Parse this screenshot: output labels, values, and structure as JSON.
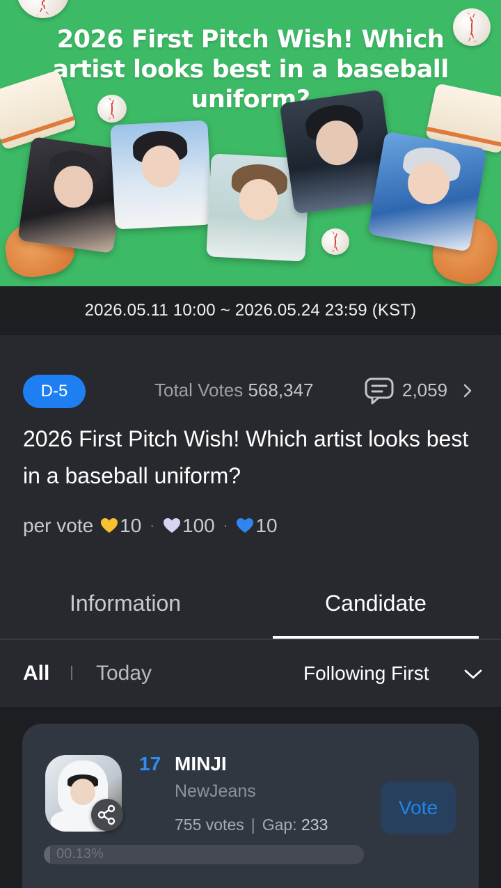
{
  "banner": {
    "title": "2026 First Pitch Wish! Which artist looks best in a baseball uniform?"
  },
  "period": "2026.05.11 10:00 ~ 2026.05.24 23:59 (KST)",
  "info": {
    "dday": "D-5",
    "total_label": "Total Votes",
    "total_value": "568,347",
    "comment_count": "2,059",
    "title": "2026 First Pitch Wish! Which artist looks best in a baseball uniform?",
    "per_vote_label": "per vote",
    "per_vote": [
      {
        "value": "10",
        "color": "#f5c12e",
        "icon": "yellow-heart-icon"
      },
      {
        "value": "100",
        "color": "#d6d4f2",
        "icon": "lavender-heart-icon"
      },
      {
        "value": "10",
        "color": "#2f86f0",
        "icon": "blue-heart-icon"
      }
    ],
    "per_vote_separator": "·"
  },
  "tabs": {
    "information": "Information",
    "candidate": "Candidate",
    "active": "candidate"
  },
  "filter": {
    "all": "All",
    "today": "Today",
    "sort": "Following First"
  },
  "candidates": [
    {
      "rank": "17",
      "name": "MINJI",
      "group": "NewJeans",
      "votes": "755 votes",
      "gap_label": "Gap:",
      "gap_value": "233",
      "vote_button": "Vote",
      "percent_label": "00.13%",
      "percent": 0.13
    }
  ],
  "colors": {
    "banner_green": "#3dba66",
    "accent_blue": "#1e7ff2",
    "background": "#28292e"
  }
}
